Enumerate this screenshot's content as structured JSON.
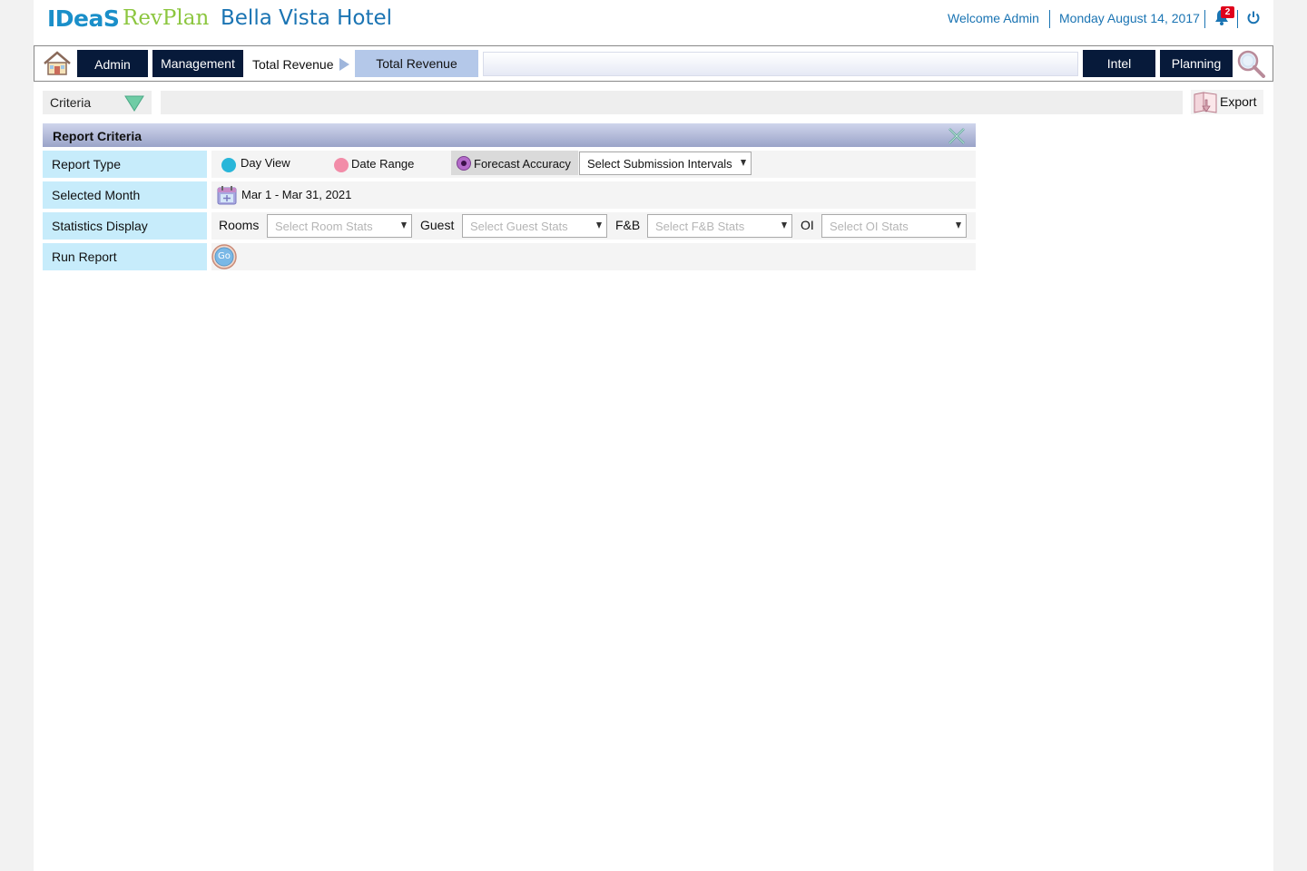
{
  "header": {
    "logo_ideas": "IDeaS",
    "logo_revplan": "RevPlan",
    "hotel_name": "Bella Vista Hotel",
    "welcome": "Welcome Admin",
    "date": "Monday August 14, 2017",
    "notification_count": "2"
  },
  "nav": {
    "admin": "Admin",
    "management": "Management",
    "crumb": "Total Revenue",
    "active": "Total Revenue",
    "intel": "Intel",
    "planning": "Planning"
  },
  "criteria_bar": {
    "label": "Criteria",
    "export": "Export"
  },
  "panel": {
    "title": "Report Criteria",
    "rows": {
      "report_type": "Report Type",
      "selected_month": "Selected Month",
      "statistics_display": "Statistics Display",
      "run_report": "Run Report"
    },
    "report_type": {
      "day_view": "Day View",
      "date_range": "Date Range",
      "forecast_accuracy": "Forecast Accuracy",
      "submission_select": "Select Submission Intervals"
    },
    "selected_month_value": "Mar 1 - Mar 31, 2021",
    "stats": {
      "rooms_label": "Rooms",
      "rooms_placeholder": "Select Room Stats",
      "guest_label": "Guest",
      "guest_placeholder": "Select Guest Stats",
      "fb_label": "F&B",
      "fb_placeholder": "Select F&B Stats",
      "oi_label": "OI",
      "oi_placeholder": "Select OI Stats"
    },
    "go_label": "Go"
  },
  "colors": {
    "brand_blue": "#1a74b3",
    "brand_green": "#8cc63f",
    "nav_dark": "#071a3a",
    "label_bg": "#c7ecfb",
    "day_view_radio": "#29b6d9",
    "date_range_radio": "#f28ca8",
    "forecast_radio": "#b36bc9"
  }
}
